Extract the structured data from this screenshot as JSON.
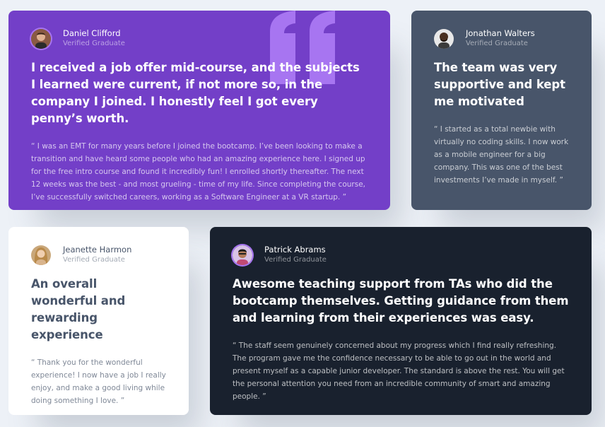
{
  "colors": {
    "background": "#edf1f7",
    "purple": "#733fc8",
    "gray_blue": "#48556a",
    "white": "#ffffff",
    "dark": "#19212e",
    "quote_mark": "#a775f1"
  },
  "testimonials": [
    {
      "name": "Daniel Clifford",
      "role": "Verified Graduate",
      "avatar_icon": "avatar-daniel",
      "headline": "I received a job offer mid-course, and the subjects I learned were current, if not more so, in the company I joined. I honestly feel I got every penny’s worth.",
      "body": "“ I was an EMT for many years before I joined the bootcamp. I’ve been looking to make a transition and have heard some people who had an amazing experience here. I signed up for the free intro course and found it incredibly fun! I enrolled shortly thereafter. The next 12 weeks was the  best - and most grueling - time of my life. Since completing the course, I’ve successfully switched careers, working as a Software Engineer at a VR startup. ”"
    },
    {
      "name": "Jonathan Walters",
      "role": "Verified Graduate",
      "avatar_icon": "avatar-jonathan",
      "headline": "The team was very supportive and kept me motivated",
      "body": "“ I started as a total newbie with virtually no coding skills. I now work as a mobile engineer for a big company. This was one of the best investments I’ve made in myself. ”"
    },
    {
      "name": "Jeanette Harmon",
      "role": "Verified Graduate",
      "avatar_icon": "avatar-jeanette",
      "headline": "An overall wonderful and rewarding experience",
      "body": "“ Thank you for the wonderful experience! I now have a job I really enjoy, and make a good living while doing something I love. ”"
    },
    {
      "name": "Patrick Abrams",
      "role": "Verified Graduate",
      "avatar_icon": "avatar-patrick",
      "headline": "Awesome teaching support from TAs who did the bootcamp themselves. Getting guidance from them and learning from their experiences was easy.",
      "body": "“ The staff seem genuinely concerned about my progress which I find really refreshing. The program gave me the confidence necessary to be able to go out in the world and present myself as a capable junior developer. The standard is above the rest. You will get the personal attention you need from an incredible community of smart and amazing people.  ”"
    }
  ]
}
